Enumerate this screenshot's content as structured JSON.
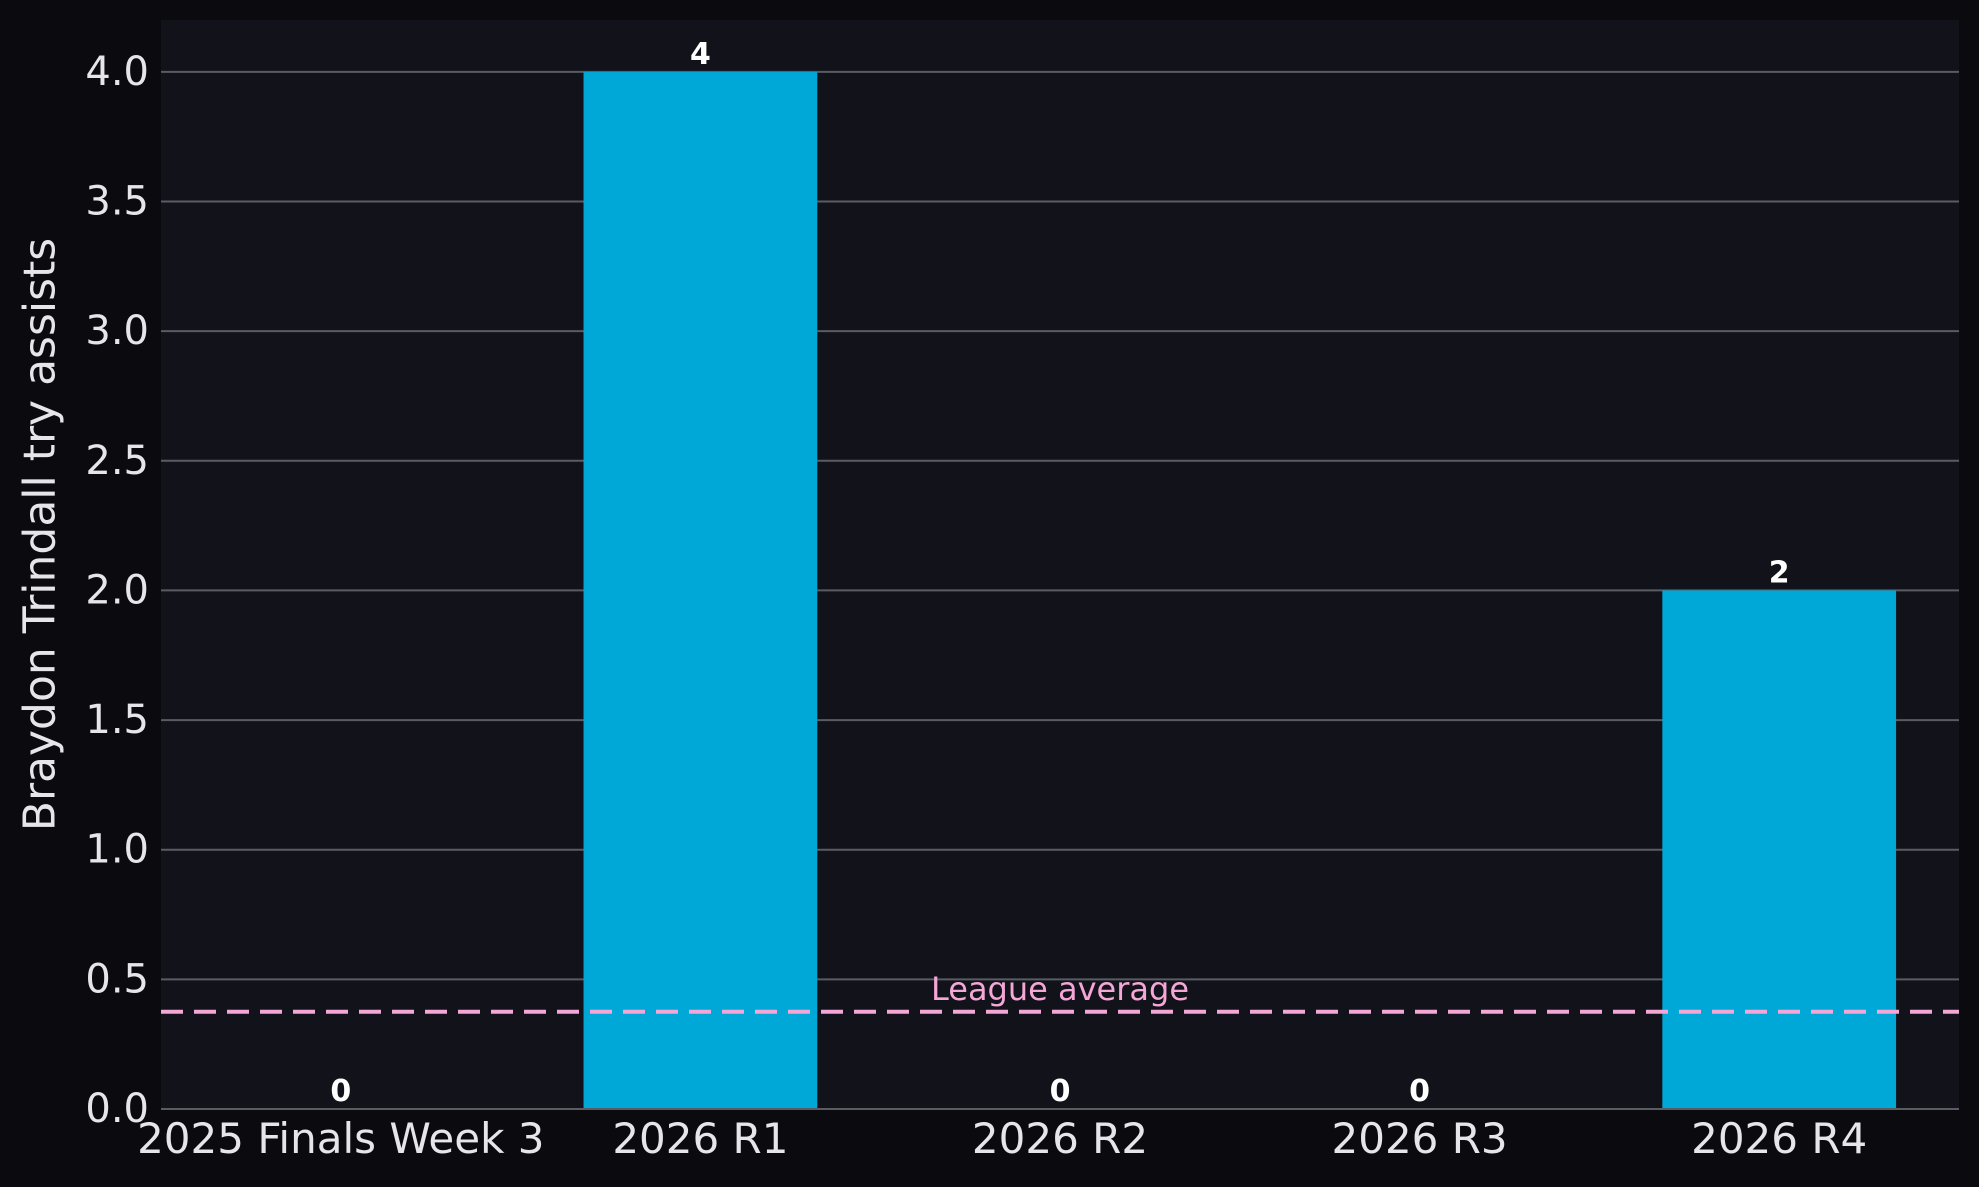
{
  "chart_data": {
    "type": "bar",
    "categories": [
      "2025 Finals Week 3",
      "2026 R1",
      "2026 R2",
      "2026 R3",
      "2026 R4"
    ],
    "values": [
      0,
      4,
      0,
      0,
      2
    ],
    "data_labels": [
      "0",
      "4",
      "0",
      "0",
      "2"
    ],
    "title": "",
    "xlabel": "",
    "ylabel": "Braydon Trindall try assists",
    "ylim": [
      0,
      4.2
    ],
    "yticks": [
      0.0,
      0.5,
      1.0,
      1.5,
      2.0,
      2.5,
      3.0,
      3.5,
      4.0
    ],
    "ytick_labels": [
      "0.0",
      "0.5",
      "1.0",
      "1.5",
      "2.0",
      "2.5",
      "3.0",
      "3.5",
      "4.0"
    ],
    "grid": "horizontal",
    "reference_line": {
      "label": "League average",
      "value": 0.375,
      "style": "dashed"
    },
    "colors": {
      "figure_bg": "#0b0b0f",
      "plot_bg": "#12131a",
      "bar": "#00a8d8",
      "grid": "#5a5c63",
      "reference_line": "#f4a6d7",
      "text": "#e6e6ea",
      "data_label": "#ffffff"
    }
  }
}
